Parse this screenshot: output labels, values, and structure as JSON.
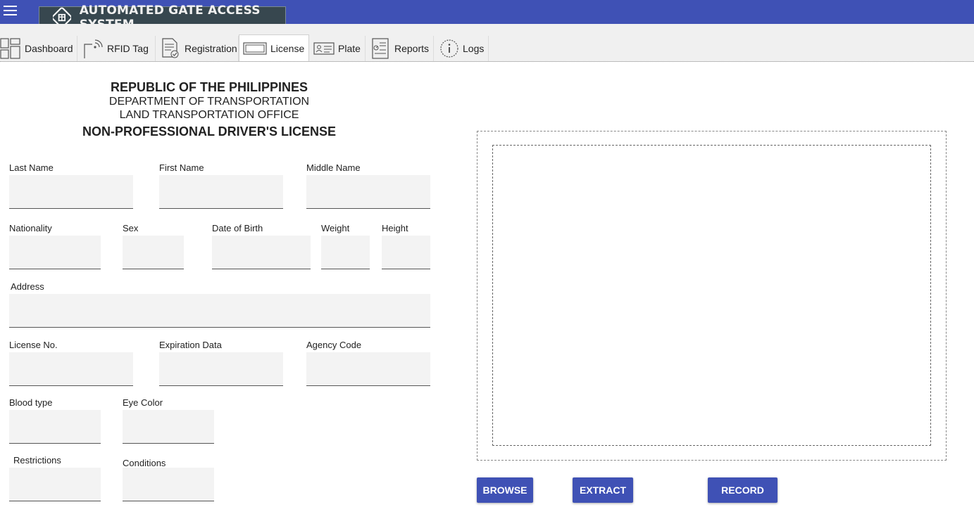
{
  "app": {
    "title": "AUTOMATED GATE ACCESS SYSTEM",
    "brand_color": "#3f51b5",
    "menu_icon": "hamburger-menu-icon"
  },
  "tabs": [
    {
      "label": "Dashboard",
      "icon": "dashboard-icon",
      "active": false
    },
    {
      "label": "RFID Tag",
      "icon": "rfid-tag-icon",
      "active": false
    },
    {
      "label": "Registration",
      "icon": "registration-icon",
      "active": false
    },
    {
      "label": "License",
      "icon": "license-card-icon",
      "active": true
    },
    {
      "label": "Plate",
      "icon": "plate-id-icon",
      "active": false
    },
    {
      "label": "Reports",
      "icon": "reports-icon",
      "active": false
    },
    {
      "label": "Logs",
      "icon": "info-icon",
      "active": false
    }
  ],
  "header": {
    "line1": "REPUBLIC OF THE PHILIPPINES",
    "line2": "DEPARTMENT OF TRANSPORTATION",
    "line3": "LAND TRANSPORTATION OFFICE",
    "line4": "NON-PROFESSIONAL DRIVER'S LICENSE"
  },
  "fields": {
    "last_name": {
      "label": "Last Name",
      "value": ""
    },
    "first_name": {
      "label": "First Name",
      "value": ""
    },
    "middle_name": {
      "label": "Middle Name",
      "value": ""
    },
    "nationality": {
      "label": "Nationality",
      "value": ""
    },
    "sex": {
      "label": "Sex",
      "value": ""
    },
    "date_of_birth": {
      "label": "Date of Birth",
      "value": ""
    },
    "weight": {
      "label": "Weight",
      "value": ""
    },
    "height": {
      "label": "Height",
      "value": ""
    },
    "address": {
      "label": "Address",
      "value": ""
    },
    "license_no": {
      "label": "License No.",
      "value": ""
    },
    "expiration": {
      "label": "Expiration Data",
      "value": ""
    },
    "agency_code": {
      "label": "Agency Code",
      "value": ""
    },
    "blood_type": {
      "label": "Blood type",
      "value": ""
    },
    "eye_color": {
      "label": "Eye Color",
      "value": ""
    },
    "restrictions": {
      "label": "Restrictions",
      "value": ""
    },
    "conditions": {
      "label": "Conditions",
      "value": ""
    }
  },
  "actions": {
    "browse": "BROWSE",
    "extract": "EXTRACT",
    "record": "RECORD"
  }
}
